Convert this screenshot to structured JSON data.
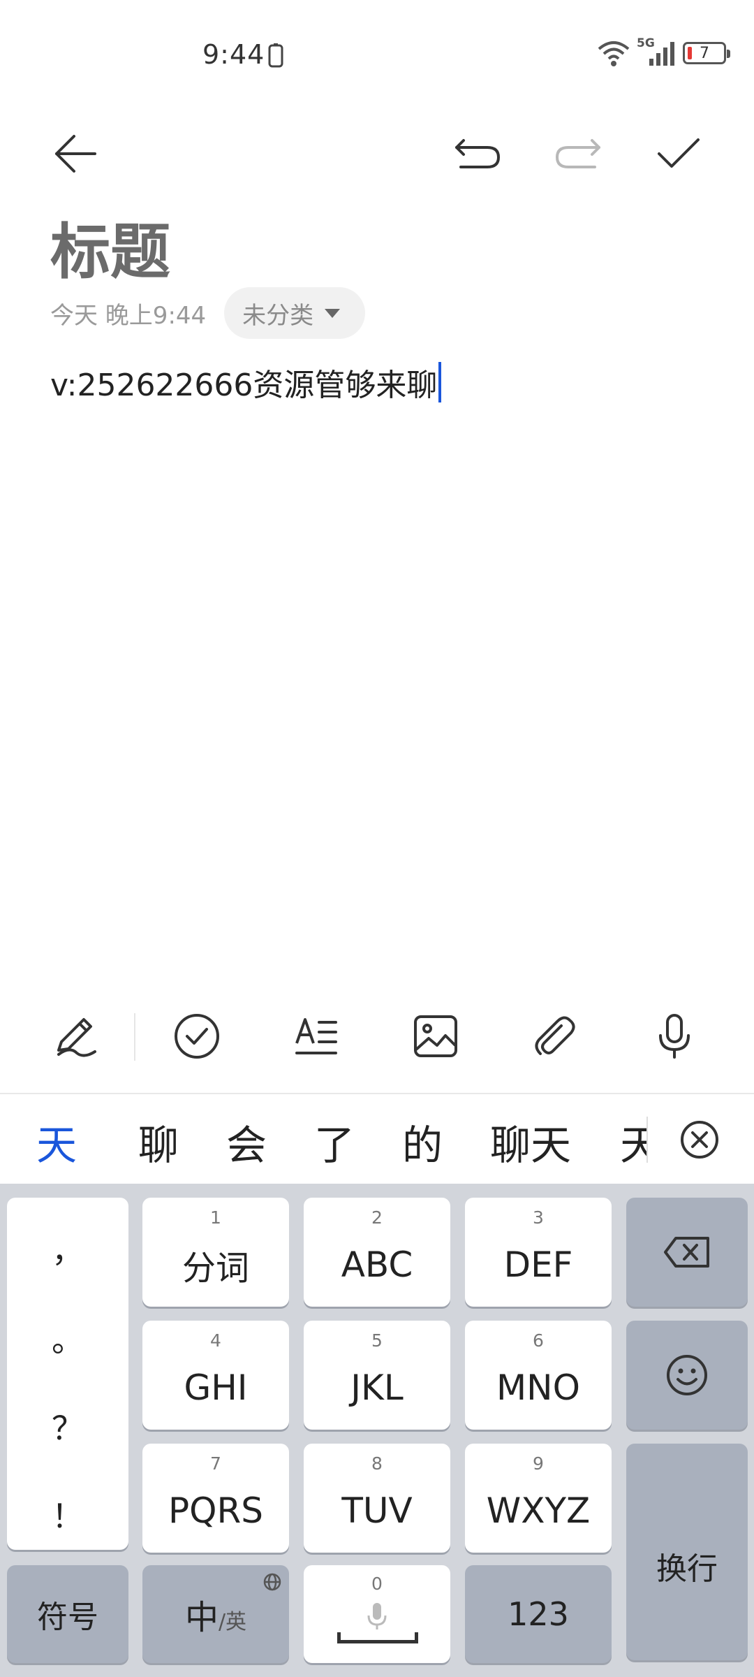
{
  "status_bar": {
    "time": "9:44",
    "network": "5G",
    "battery": "7"
  },
  "toolbar": {
    "back": "back-arrow-icon",
    "undo": "undo-icon",
    "redo": "redo-icon",
    "done": "check-icon"
  },
  "note": {
    "title": "标题",
    "date": "今天 晚上9:44",
    "category": "未分类",
    "body": "v:252622666资源管够来聊"
  },
  "edit_toolbar": {
    "items": [
      "handwriting-icon",
      "checklist-icon",
      "text-format-icon",
      "image-icon",
      "attachment-icon",
      "microphone-icon"
    ]
  },
  "candidates": [
    "天",
    "聊",
    "会",
    "了",
    "的",
    "聊天",
    "天"
  ],
  "keyboard": {
    "punctuation": [
      "，",
      "。",
      "？",
      "！"
    ],
    "keys": [
      {
        "num": "1",
        "label": "分词"
      },
      {
        "num": "2",
        "label": "ABC"
      },
      {
        "num": "3",
        "label": "DEF"
      },
      {
        "num": "4",
        "label": "GHI"
      },
      {
        "num": "5",
        "label": "JKL"
      },
      {
        "num": "6",
        "label": "MNO"
      },
      {
        "num": "7",
        "label": "PQRS"
      },
      {
        "num": "8",
        "label": "TUV"
      },
      {
        "num": "9",
        "label": "WXYZ"
      }
    ],
    "symbols": "符号",
    "lang_main": "中",
    "lang_sub": "/英",
    "space_num": "0",
    "num_mode": "123",
    "enter": "换行"
  },
  "colors": {
    "accent": "#1a56db",
    "keyboard_bg": "#d2d5db",
    "dark_key": "#a9b0bd",
    "battery_low": "#e53935"
  }
}
